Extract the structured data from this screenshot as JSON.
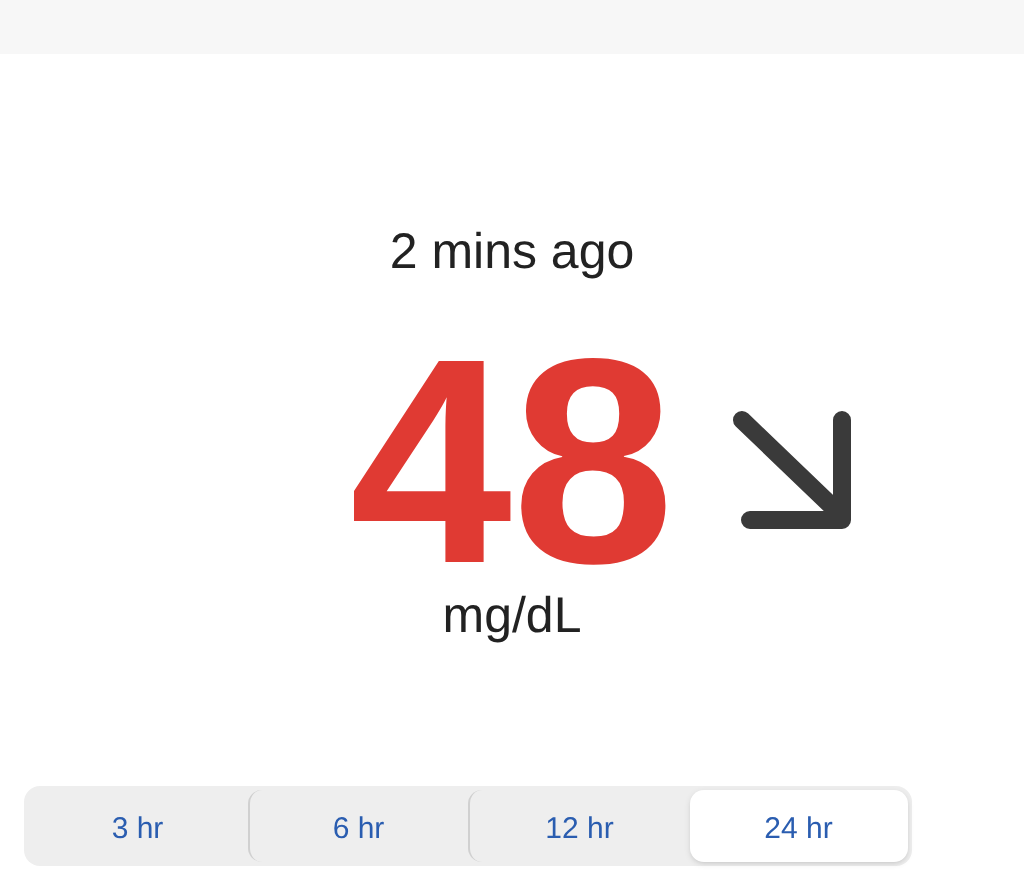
{
  "reading": {
    "age": "2 mins ago",
    "value": "48",
    "unit": "mg/dL"
  },
  "range_tabs": [
    {
      "label": "3 hr",
      "selected": false
    },
    {
      "label": "6 hr",
      "selected": false
    },
    {
      "label": "12 hr",
      "selected": false
    },
    {
      "label": "24 hr",
      "selected": true
    }
  ]
}
